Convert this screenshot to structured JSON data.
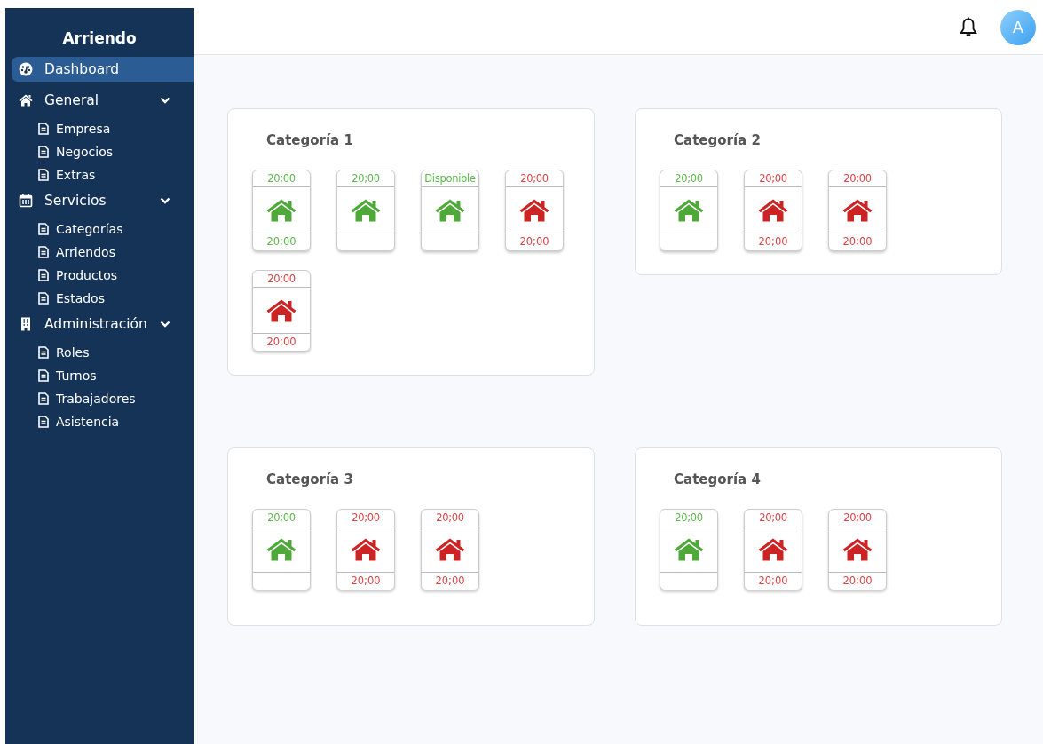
{
  "sidebar": {
    "title": "Arriendo",
    "items": [
      {
        "label": "Dashboard",
        "kind": "gauge",
        "selected": true
      },
      {
        "label": "General",
        "kind": "home",
        "selected": false,
        "expanded": true,
        "children": [
          {
            "label": "Empresa"
          },
          {
            "label": "Negocios"
          },
          {
            "label": "Extras"
          }
        ]
      },
      {
        "label": "Servicios",
        "kind": "calendar",
        "selected": false,
        "expanded": true,
        "children": [
          {
            "label": "Categorías"
          },
          {
            "label": "Arriendos"
          },
          {
            "label": "Productos"
          },
          {
            "label": "Estados"
          }
        ]
      },
      {
        "label": "Administración",
        "kind": "building",
        "selected": false,
        "expanded": true,
        "children": [
          {
            "label": "Roles"
          },
          {
            "label": "Turnos"
          },
          {
            "label": "Trabajadores"
          },
          {
            "label": "Asistencia"
          }
        ]
      }
    ]
  },
  "header": {
    "avatar": "A"
  },
  "categories": [
    {
      "title": "Categoría 1",
      "units": [
        {
          "kind": "free",
          "top": "20;00",
          "bottom": "20;00"
        },
        {
          "kind": "free",
          "top": "20;00"
        },
        {
          "kind": "free",
          "top": "Disponible"
        },
        {
          "kind": "taken",
          "top": "20;00",
          "bottom": "20;00"
        },
        {
          "kind": "taken",
          "top": "20;00",
          "bottom": "20;00"
        }
      ]
    },
    {
      "title": "Categoría 2",
      "units": [
        {
          "kind": "free",
          "top": "20;00"
        },
        {
          "kind": "taken",
          "top": "20;00",
          "bottom": "20;00"
        },
        {
          "kind": "taken",
          "top": "20;00",
          "bottom": "20;00"
        }
      ]
    },
    {
      "title": "Categoría 3",
      "units": [
        {
          "kind": "free",
          "top": "20;00"
        },
        {
          "kind": "taken",
          "top": "20;00",
          "bottom": "20;00"
        },
        {
          "kind": "taken",
          "top": "20;00",
          "bottom": "20;00"
        }
      ]
    },
    {
      "title": "Categoría 4",
      "units": [
        {
          "kind": "free",
          "top": "20;00"
        },
        {
          "kind": "taken",
          "top": "20;00",
          "bottom": "20;00"
        },
        {
          "kind": "taken",
          "top": "20;00",
          "bottom": "20;00"
        }
      ]
    }
  ]
}
